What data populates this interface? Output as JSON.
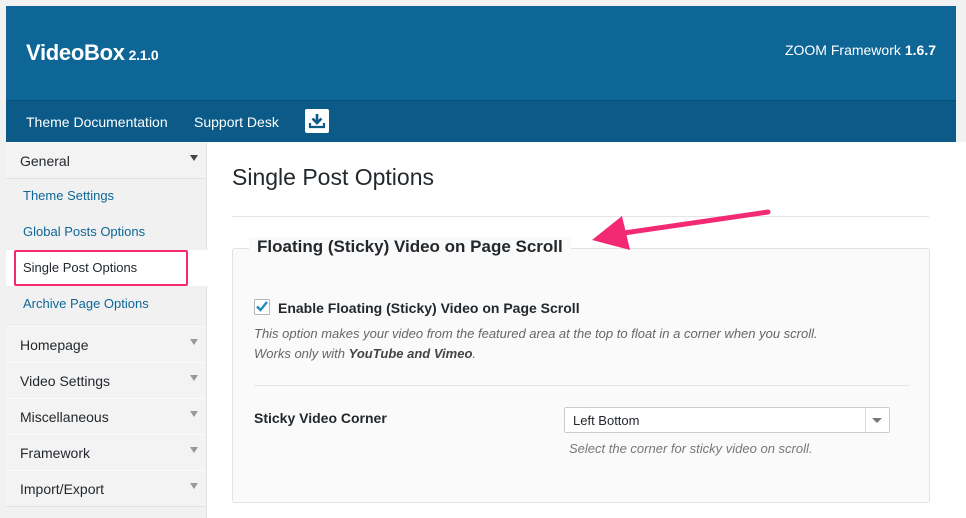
{
  "header": {
    "app_name": "VideoBox",
    "app_version": "2.1.0",
    "framework_label": "ZOOM Framework",
    "framework_version": "1.6.7"
  },
  "subnav": {
    "doc_link": "Theme Documentation",
    "support_link": "Support Desk",
    "download_icon": "download-icon"
  },
  "sidebar": {
    "general": "General",
    "sub_items": [
      "Theme Settings",
      "Global Posts Options",
      "Single Post Options",
      "Archive Page Options"
    ],
    "sections": [
      "Homepage",
      "Video Settings",
      "Miscellaneous",
      "Framework",
      "Import/Export"
    ]
  },
  "main": {
    "page_title": "Single Post Options",
    "section_title": "Floating (Sticky) Video on Page Scroll",
    "checkbox_label": "Enable Floating (Sticky) Video on Page Scroll",
    "checkbox_checked": true,
    "desc_line1": "This option makes your video from the featured area at the top to float in a corner when you scroll.",
    "desc_line2_prefix": "Works only with ",
    "desc_line2_bold": "YouTube and Vimeo",
    "desc_line2_suffix": ".",
    "corner_label": "Sticky Video Corner",
    "corner_value": "Left Bottom",
    "corner_help": "Select the corner for sticky video on scroll."
  },
  "colors": {
    "header_bg": "#0e6697",
    "subnav_bg": "#0b5a87",
    "link": "#0e6697",
    "annotation_accent": "#f32a73",
    "checkbox_check": "#1e8cbe"
  }
}
